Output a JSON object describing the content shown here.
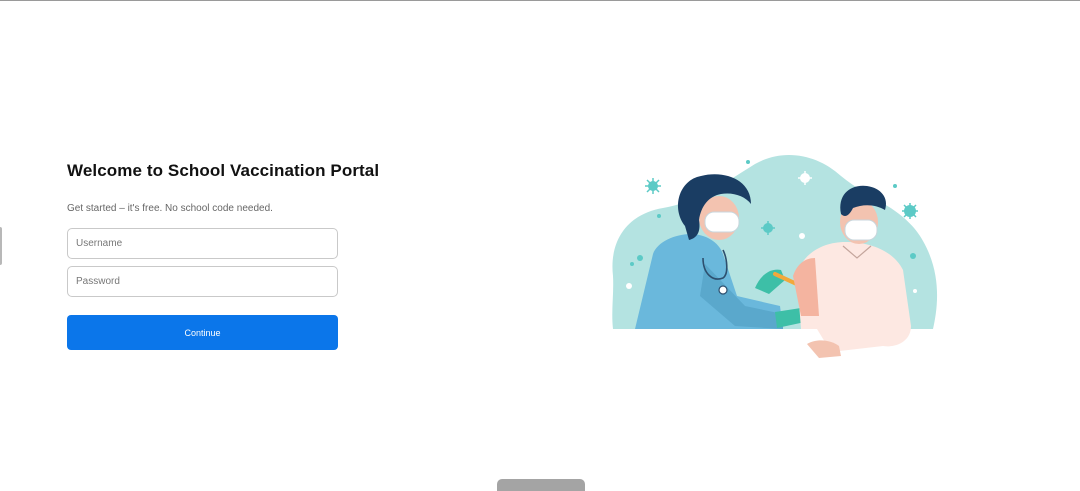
{
  "login": {
    "title": "Welcome to School Vaccination Portal",
    "subtitle": "Get started – it's free. No school code needed.",
    "username_placeholder": "Username",
    "password_placeholder": "Password",
    "continue_label": "Continue"
  },
  "colors": {
    "primary": "#0b76ea",
    "illustration_bg": "#b4e3e1",
    "scrub_blue": "#6ab8dc",
    "hair_navy": "#1a3d63",
    "patient_shirt": "#fde8e2"
  },
  "icons": {
    "illustration": "vaccination-illustration"
  }
}
